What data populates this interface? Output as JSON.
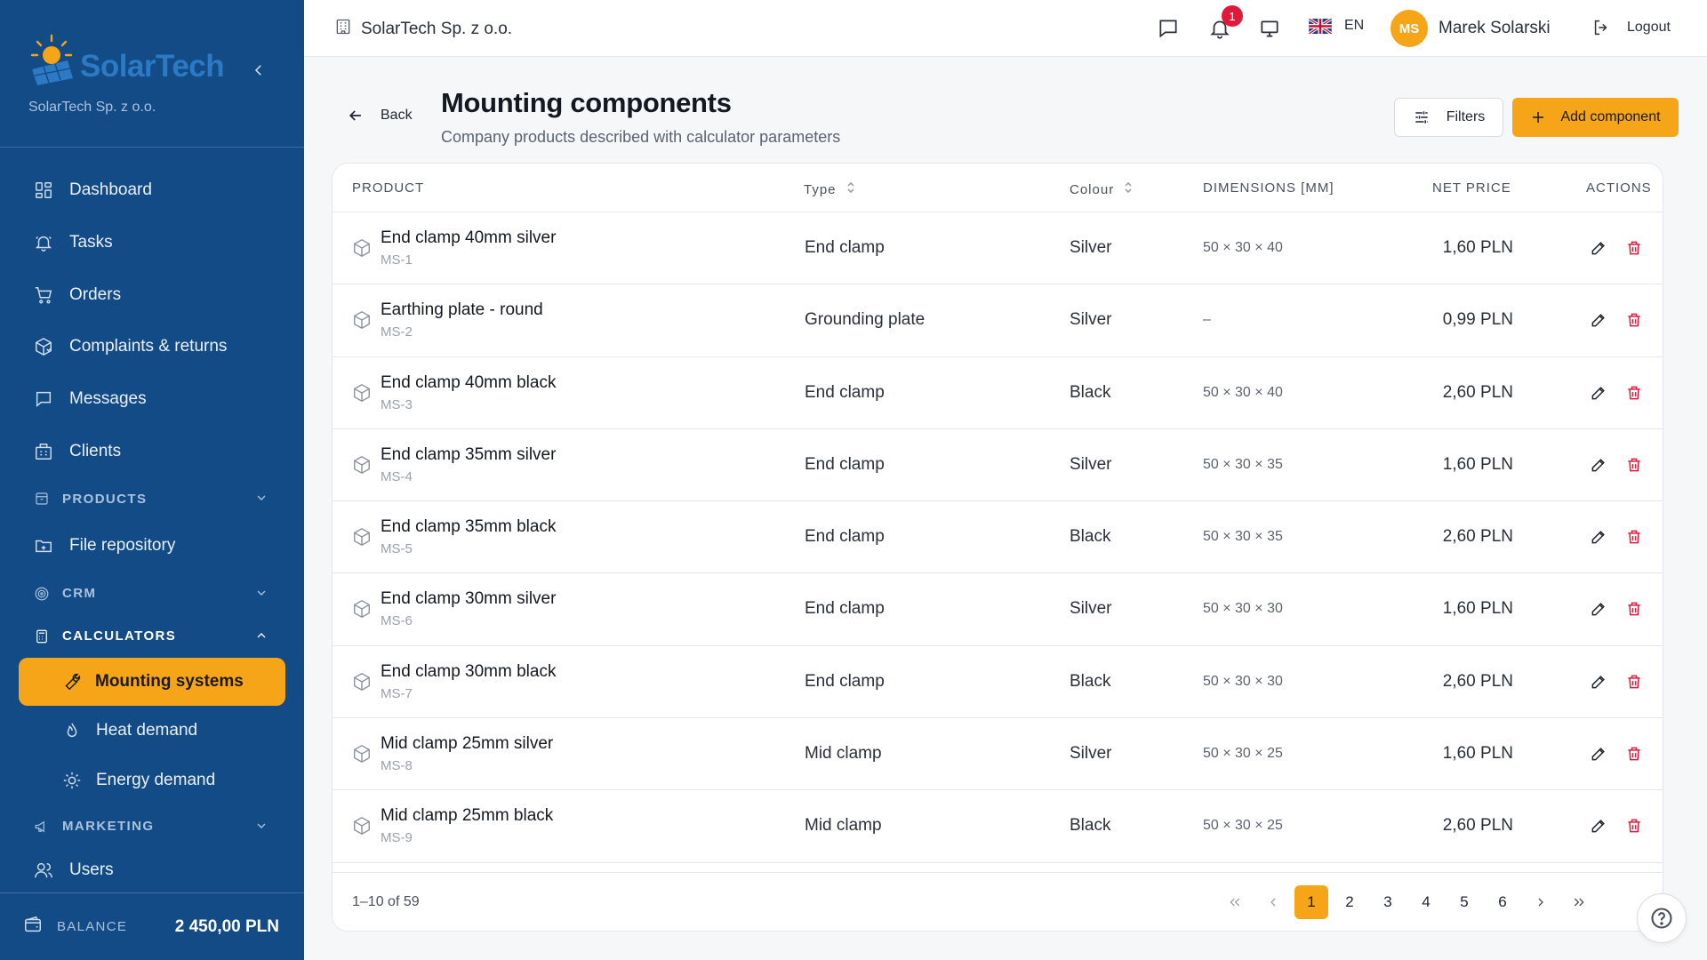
{
  "brand": {
    "name": "SolarTech",
    "company": "SolarTech Sp. z o.o."
  },
  "sidebar": {
    "items": [
      {
        "label": "Dashboard",
        "icon": "dashboard-icon"
      },
      {
        "label": "Tasks",
        "icon": "bell-ring-icon"
      },
      {
        "label": "Orders",
        "icon": "cart-icon"
      },
      {
        "label": "Complaints & returns",
        "icon": "package-return-icon"
      },
      {
        "label": "Messages",
        "icon": "message-icon"
      },
      {
        "label": "Clients",
        "icon": "building-icon"
      }
    ],
    "sections": {
      "products": "PRODUCTS",
      "file_repository": "File repository",
      "crm": "CRM",
      "calculators": "CALCULATORS",
      "marketing": "MARKETING",
      "users": "Users"
    },
    "calculator_items": [
      {
        "label": "Mounting systems",
        "icon": "wrench-icon",
        "active": true
      },
      {
        "label": "Heat demand",
        "icon": "flame-icon",
        "active": false
      },
      {
        "label": "Energy demand",
        "icon": "sun-icon",
        "active": false
      }
    ],
    "balance": {
      "label": "BALANCE",
      "value": "2 450,00 PLN"
    }
  },
  "topbar": {
    "company": "SolarTech Sp. z o.o.",
    "notifications_count": "1",
    "language": "EN",
    "user_initials": "MS",
    "user_name": "Marek Solarski",
    "logout": "Logout"
  },
  "page": {
    "back": "Back",
    "title": "Mounting components",
    "subtitle": "Company products described with calculator parameters",
    "filters": "Filters",
    "add": "Add component"
  },
  "table": {
    "headers": {
      "product": "PRODUCT",
      "type": "Type",
      "colour": "Colour",
      "dimensions": "DIMENSIONS [MM]",
      "price": "NET PRICE",
      "actions": "ACTIONS"
    },
    "rows": [
      {
        "name": "End clamp 40mm silver",
        "sku": "MS-1",
        "type": "End clamp",
        "colour": "Silver",
        "dims": "50 × 30 × 40",
        "price": "1,60 PLN"
      },
      {
        "name": "Earthing plate - round",
        "sku": "MS-2",
        "type": "Grounding plate",
        "colour": "Silver",
        "dims": "–",
        "price": "0,99 PLN"
      },
      {
        "name": "End clamp 40mm black",
        "sku": "MS-3",
        "type": "End clamp",
        "colour": "Black",
        "dims": "50 × 30 × 40",
        "price": "2,60 PLN"
      },
      {
        "name": "End clamp 35mm silver",
        "sku": "MS-4",
        "type": "End clamp",
        "colour": "Silver",
        "dims": "50 × 30 × 35",
        "price": "1,60 PLN"
      },
      {
        "name": "End clamp 35mm black",
        "sku": "MS-5",
        "type": "End clamp",
        "colour": "Black",
        "dims": "50 × 30 × 35",
        "price": "2,60 PLN"
      },
      {
        "name": "End clamp 30mm silver",
        "sku": "MS-6",
        "type": "End clamp",
        "colour": "Silver",
        "dims": "50 × 30 × 30",
        "price": "1,60 PLN"
      },
      {
        "name": "End clamp 30mm black",
        "sku": "MS-7",
        "type": "End clamp",
        "colour": "Black",
        "dims": "50 × 30 × 30",
        "price": "2,60 PLN"
      },
      {
        "name": "Mid clamp 25mm silver",
        "sku": "MS-8",
        "type": "Mid clamp",
        "colour": "Silver",
        "dims": "50 × 30 × 25",
        "price": "1,60 PLN"
      },
      {
        "name": "Mid clamp 25mm black",
        "sku": "MS-9",
        "type": "Mid clamp",
        "colour": "Black",
        "dims": "50 × 30 × 25",
        "price": "2,60 PLN"
      }
    ],
    "range": "1–10 of 59",
    "pages": [
      "1",
      "2",
      "3",
      "4",
      "5",
      "6"
    ],
    "current_page": "1"
  },
  "colors": {
    "sidebar": "#134b86",
    "accent": "#f5a517",
    "danger": "#e0193a"
  }
}
